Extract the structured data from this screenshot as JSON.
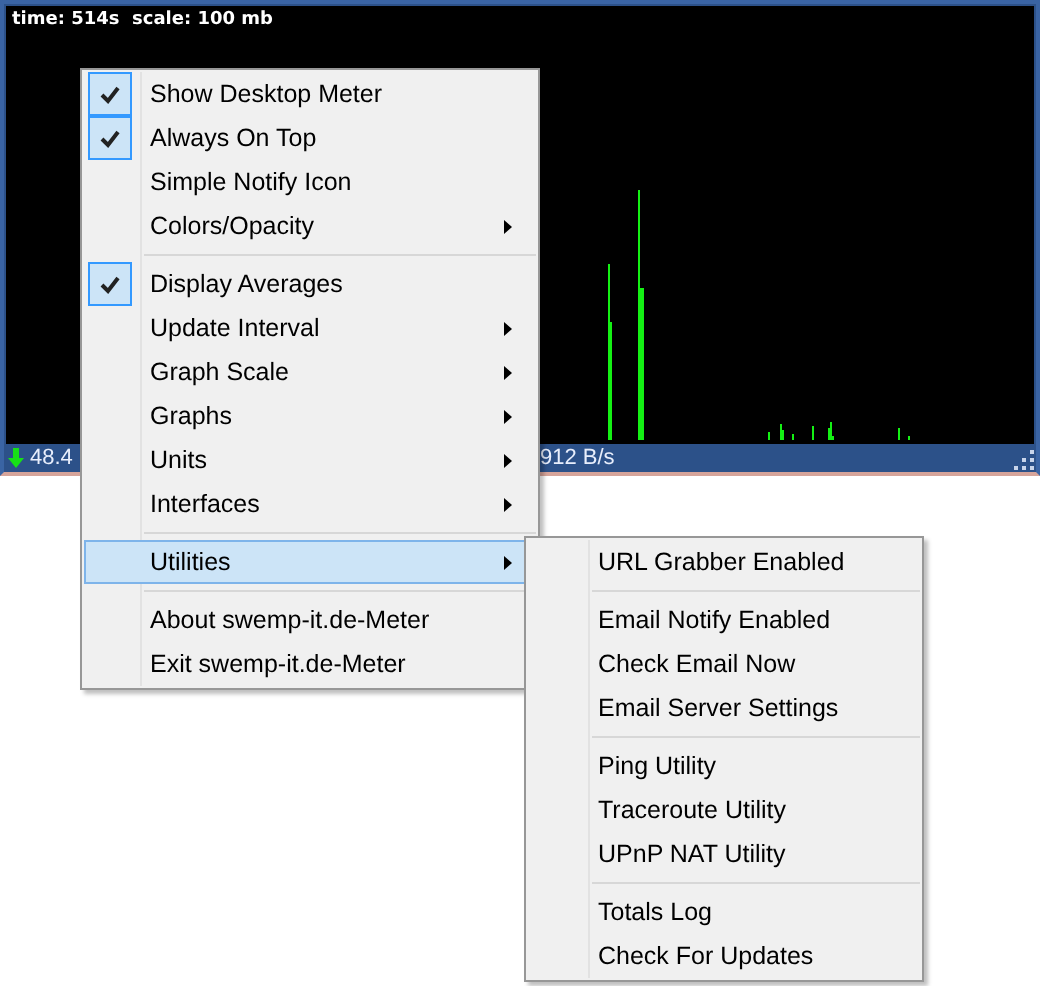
{
  "meter": {
    "header": "time: 514s  scale: 100 mb",
    "download_rate": "48.4",
    "upload_rate": "912 B/s"
  },
  "context_menu": {
    "items": [
      {
        "kind": "item",
        "label": "Show Desktop Meter",
        "checked": true,
        "submenu": false,
        "selected": false
      },
      {
        "kind": "item",
        "label": "Always On Top",
        "checked": true,
        "submenu": false,
        "selected": false
      },
      {
        "kind": "item",
        "label": "Simple Notify Icon",
        "checked": false,
        "submenu": false,
        "selected": false
      },
      {
        "kind": "item",
        "label": "Colors/Opacity",
        "checked": false,
        "submenu": true,
        "selected": false
      },
      {
        "kind": "separator"
      },
      {
        "kind": "item",
        "label": "Display Averages",
        "checked": true,
        "submenu": false,
        "selected": false
      },
      {
        "kind": "item",
        "label": "Update Interval",
        "checked": false,
        "submenu": true,
        "selected": false
      },
      {
        "kind": "item",
        "label": "Graph Scale",
        "checked": false,
        "submenu": true,
        "selected": false
      },
      {
        "kind": "item",
        "label": "Graphs",
        "checked": false,
        "submenu": true,
        "selected": false
      },
      {
        "kind": "item",
        "label": "Units",
        "checked": false,
        "submenu": true,
        "selected": false
      },
      {
        "kind": "item",
        "label": "Interfaces",
        "checked": false,
        "submenu": true,
        "selected": false
      },
      {
        "kind": "separator"
      },
      {
        "kind": "item",
        "label": "Utilities",
        "checked": false,
        "submenu": true,
        "selected": true
      },
      {
        "kind": "separator"
      },
      {
        "kind": "item",
        "label": "About swemp-it.de-Meter",
        "checked": false,
        "submenu": false,
        "selected": false
      },
      {
        "kind": "item",
        "label": "Exit swemp-it.de-Meter",
        "checked": false,
        "submenu": false,
        "selected": false
      }
    ]
  },
  "utilities_submenu": {
    "items": [
      {
        "kind": "item",
        "label": "URL Grabber Enabled",
        "checked": false,
        "submenu": false,
        "selected": false
      },
      {
        "kind": "separator"
      },
      {
        "kind": "item",
        "label": "Email Notify Enabled",
        "checked": false,
        "submenu": false,
        "selected": false
      },
      {
        "kind": "item",
        "label": "Check Email Now",
        "checked": false,
        "submenu": false,
        "selected": false
      },
      {
        "kind": "item",
        "label": "Email Server Settings",
        "checked": false,
        "submenu": false,
        "selected": false
      },
      {
        "kind": "separator"
      },
      {
        "kind": "item",
        "label": "Ping Utility",
        "checked": false,
        "submenu": false,
        "selected": false
      },
      {
        "kind": "item",
        "label": "Traceroute Utility",
        "checked": false,
        "submenu": false,
        "selected": false
      },
      {
        "kind": "item",
        "label": "UPnP NAT Utility",
        "checked": false,
        "submenu": false,
        "selected": false
      },
      {
        "kind": "separator"
      },
      {
        "kind": "item",
        "label": "Totals Log",
        "checked": false,
        "submenu": false,
        "selected": false
      },
      {
        "kind": "item",
        "label": "Check For Updates",
        "checked": false,
        "submenu": false,
        "selected": false
      }
    ]
  }
}
